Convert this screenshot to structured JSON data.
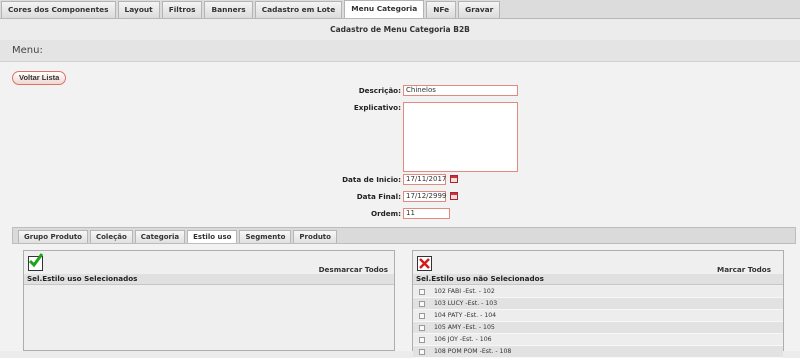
{
  "nav": {
    "tabs": [
      "Cores dos Componentes",
      "Layout",
      "Filtros",
      "Banners",
      "Cadastro em Lote",
      "Menu Categoria",
      "NFe",
      "Gravar"
    ],
    "active_index": 5
  },
  "page_title": "Cadastro de Menu Categoria B2B",
  "menu_header": "Menu:",
  "voltar_label": "Voltar Lista",
  "form": {
    "descricao_label": "Descrição:",
    "descricao_value": "Chinelos",
    "explicativo_label": "Explicativo:",
    "data_inicio_label": "Data de Inicio:",
    "data_inicio_value": "17/11/2017",
    "data_final_label": "Data Final:",
    "data_final_value": "17/12/2999",
    "ordem_label": "Ordem:",
    "ordem_value": "11"
  },
  "sub_tabs": {
    "tabs": [
      "Grupo Produto",
      "Coleção",
      "Categoria",
      "Estilo uso",
      "Segmento",
      "Produto"
    ],
    "active_index": 3
  },
  "left_box": {
    "title": "Sel.Estilo uso Selecionados",
    "action": "Desmarcar Todos",
    "icon": "green-check-icon"
  },
  "right_box": {
    "title": "Sel.Estilo uso não Selecionados",
    "action": "Marcar Todos",
    "icon": "red-x-icon",
    "items": [
      "102 FABI -Est. - 102",
      "103 LUCY -Est. - 103",
      "104 PATY -Est. - 104",
      "105 AMY -Est. - 105",
      "106 JOY -Est. - 106",
      "108 POM POM -Est. - 108"
    ]
  }
}
